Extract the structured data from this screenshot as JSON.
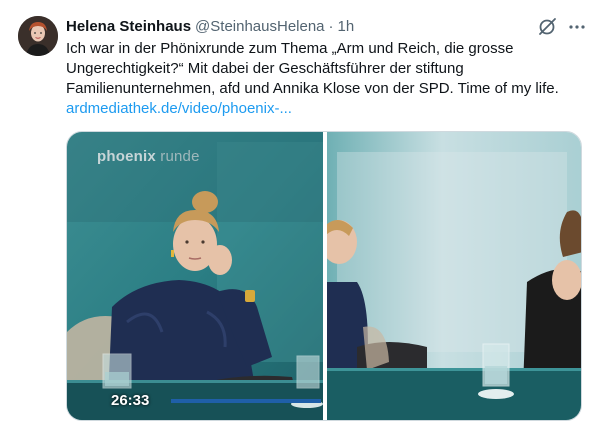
{
  "tweet": {
    "author_name": "Helena Steinhaus",
    "handle": "@SteinhausHelena",
    "separator": "·",
    "time": "1h",
    "text_lines": [
      "Ich war in der Phönixrunde zum Thema „Arm und Reich, die grosse",
      "Ungerechtigkeit?“ Mit dabei der Geschäftsführer der stiftung",
      "Familienunternehmen, afd und Annika Klose von der SPD. Time of my life."
    ],
    "link": "ardmediathek.de/video/phoenix-..."
  },
  "icons": {
    "grok": "grok-icon",
    "more": "more-icon"
  },
  "media": {
    "watermark_brand": "phoenix",
    "watermark_suffix": "runde",
    "timestamp": "26:33"
  },
  "colors": {
    "link": "#1d9bf0",
    "muted": "#536471",
    "studio_teal": "#2c8e93"
  }
}
